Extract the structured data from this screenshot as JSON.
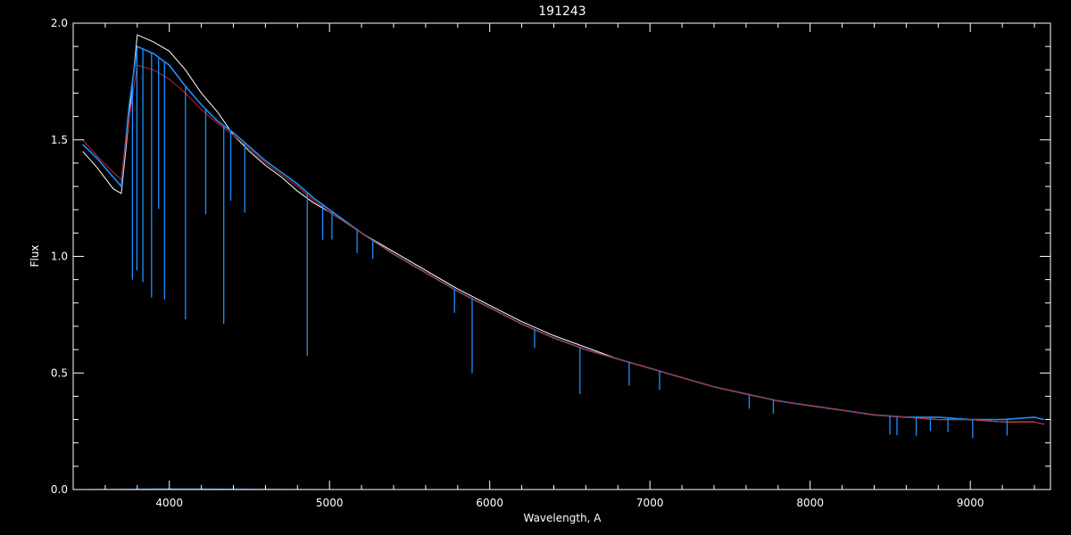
{
  "chart_data": {
    "type": "line",
    "title": "191243",
    "xlabel": "Wavelength, A",
    "ylabel": "Flux",
    "xlim": [
      3400,
      9500
    ],
    "ylim": [
      0.0,
      2.0
    ],
    "x_ticks": [
      4000,
      5000,
      6000,
      7000,
      8000,
      9000
    ],
    "x_tick_labels": [
      "4000",
      "5000",
      "6000",
      "7000",
      "8000",
      "9000"
    ],
    "y_ticks": [
      0.0,
      0.5,
      1.0,
      1.5,
      2.0
    ],
    "y_tick_labels": [
      "0.0",
      "0.5",
      "1.0",
      "1.5",
      "2.0"
    ],
    "background": "#000000",
    "axis_color": "#ffffff",
    "series": [
      {
        "color": "#ffffff",
        "x": [
          3460,
          3550,
          3650,
          3700,
          3750,
          3800,
          3900,
          4000,
          4100,
          4200,
          4300,
          4400,
          4500,
          4600,
          4700,
          4800,
          4900,
          5000,
          5200,
          5400,
          5600,
          5800,
          6000,
          6200,
          6400,
          6600,
          6800,
          7000,
          7200,
          7400,
          7600,
          7800,
          8000,
          8200,
          8400,
          8600,
          8800,
          9000,
          9200,
          9400,
          9460
        ],
        "y": [
          1.45,
          1.38,
          1.29,
          1.27,
          1.6,
          1.95,
          1.92,
          1.88,
          1.8,
          1.7,
          1.62,
          1.52,
          1.45,
          1.39,
          1.34,
          1.28,
          1.23,
          1.19,
          1.1,
          1.02,
          0.94,
          0.86,
          0.79,
          0.72,
          0.66,
          0.61,
          0.56,
          0.52,
          0.48,
          0.44,
          0.41,
          0.38,
          0.36,
          0.34,
          0.32,
          0.31,
          0.3,
          0.3,
          0.29,
          0.29,
          0.28
        ]
      },
      {
        "color": "#1e8fff",
        "x": [
          3460,
          3550,
          3650,
          3700,
          3750,
          3800,
          3900,
          4000,
          4100,
          4200,
          4300,
          4400,
          4500,
          4600,
          4700,
          4800,
          4900,
          5000,
          5200,
          5400,
          5600,
          5800,
          6000,
          6200,
          6400,
          6600,
          6800,
          7000,
          7200,
          7400,
          7600,
          7800,
          8000,
          8200,
          8400,
          8600,
          8800,
          9000,
          9200,
          9400,
          9460
        ],
        "y": [
          1.48,
          1.42,
          1.34,
          1.3,
          1.65,
          1.9,
          1.87,
          1.82,
          1.73,
          1.65,
          1.58,
          1.53,
          1.47,
          1.41,
          1.36,
          1.31,
          1.25,
          1.2,
          1.1,
          1.01,
          0.93,
          0.85,
          0.78,
          0.71,
          0.65,
          0.6,
          0.56,
          0.52,
          0.48,
          0.44,
          0.41,
          0.38,
          0.36,
          0.34,
          0.32,
          0.31,
          0.31,
          0.3,
          0.3,
          0.31,
          0.3
        ]
      },
      {
        "color": "#cc2222",
        "x": [
          3460,
          3550,
          3650,
          3700,
          3750,
          3800,
          3900,
          4000,
          4100,
          4200,
          4300,
          4400,
          4500,
          4600,
          4700,
          4800,
          4900,
          5000,
          5200,
          5400,
          5600,
          5800,
          6000,
          6200,
          6400,
          6600,
          6800,
          7000,
          7200,
          7400,
          7600,
          7800,
          8000,
          8200,
          8400,
          8600,
          8800,
          9000,
          9200,
          9400,
          9460
        ],
        "y": [
          1.5,
          1.43,
          1.36,
          1.33,
          1.6,
          1.82,
          1.8,
          1.76,
          1.7,
          1.63,
          1.57,
          1.52,
          1.46,
          1.4,
          1.35,
          1.3,
          1.24,
          1.19,
          1.1,
          1.01,
          0.93,
          0.85,
          0.78,
          0.71,
          0.65,
          0.6,
          0.56,
          0.52,
          0.48,
          0.44,
          0.41,
          0.38,
          0.36,
          0.34,
          0.32,
          0.31,
          0.3,
          0.3,
          0.29,
          0.29,
          0.28
        ]
      },
      {
        "color": "#1e8fff",
        "x": [
          3460,
          4000,
          5000,
          6000,
          7000,
          8000,
          9000,
          9460
        ],
        "y": [
          0.0,
          0.003,
          0.0,
          0.0,
          0.0,
          0.0,
          0.0,
          0.0
        ]
      }
    ],
    "absorption_lines": [
      {
        "x": 3770,
        "depth": 0.85
      },
      {
        "x": 3798,
        "depth": 0.95
      },
      {
        "x": 3835,
        "depth": 1.0
      },
      {
        "x": 3889,
        "depth": 1.05
      },
      {
        "x": 3933,
        "depth": 0.65
      },
      {
        "x": 3970,
        "depth": 1.02
      },
      {
        "x": 4101,
        "depth": 1.0
      },
      {
        "x": 4227,
        "depth": 0.45
      },
      {
        "x": 4340,
        "depth": 0.85
      },
      {
        "x": 4383,
        "depth": 0.3
      },
      {
        "x": 4471,
        "depth": 0.3
      },
      {
        "x": 4861,
        "depth": 0.7
      },
      {
        "x": 4957,
        "depth": 0.15
      },
      {
        "x": 5015,
        "depth": 0.12
      },
      {
        "x": 5172,
        "depth": 0.1
      },
      {
        "x": 5270,
        "depth": 0.08
      },
      {
        "x": 5780,
        "depth": 0.1
      },
      {
        "x": 5890,
        "depth": 0.32
      },
      {
        "x": 6280,
        "depth": 0.08
      },
      {
        "x": 6563,
        "depth": 0.2
      },
      {
        "x": 6870,
        "depth": 0.1
      },
      {
        "x": 7060,
        "depth": 0.08
      },
      {
        "x": 7620,
        "depth": 0.06
      },
      {
        "x": 7770,
        "depth": 0.06
      },
      {
        "x": 8498,
        "depth": 0.08
      },
      {
        "x": 8542,
        "depth": 0.08
      },
      {
        "x": 8662,
        "depth": 0.08
      },
      {
        "x": 8750,
        "depth": 0.06
      },
      {
        "x": 8860,
        "depth": 0.06
      },
      {
        "x": 9014,
        "depth": 0.08
      },
      {
        "x": 9229,
        "depth": 0.07
      }
    ]
  }
}
